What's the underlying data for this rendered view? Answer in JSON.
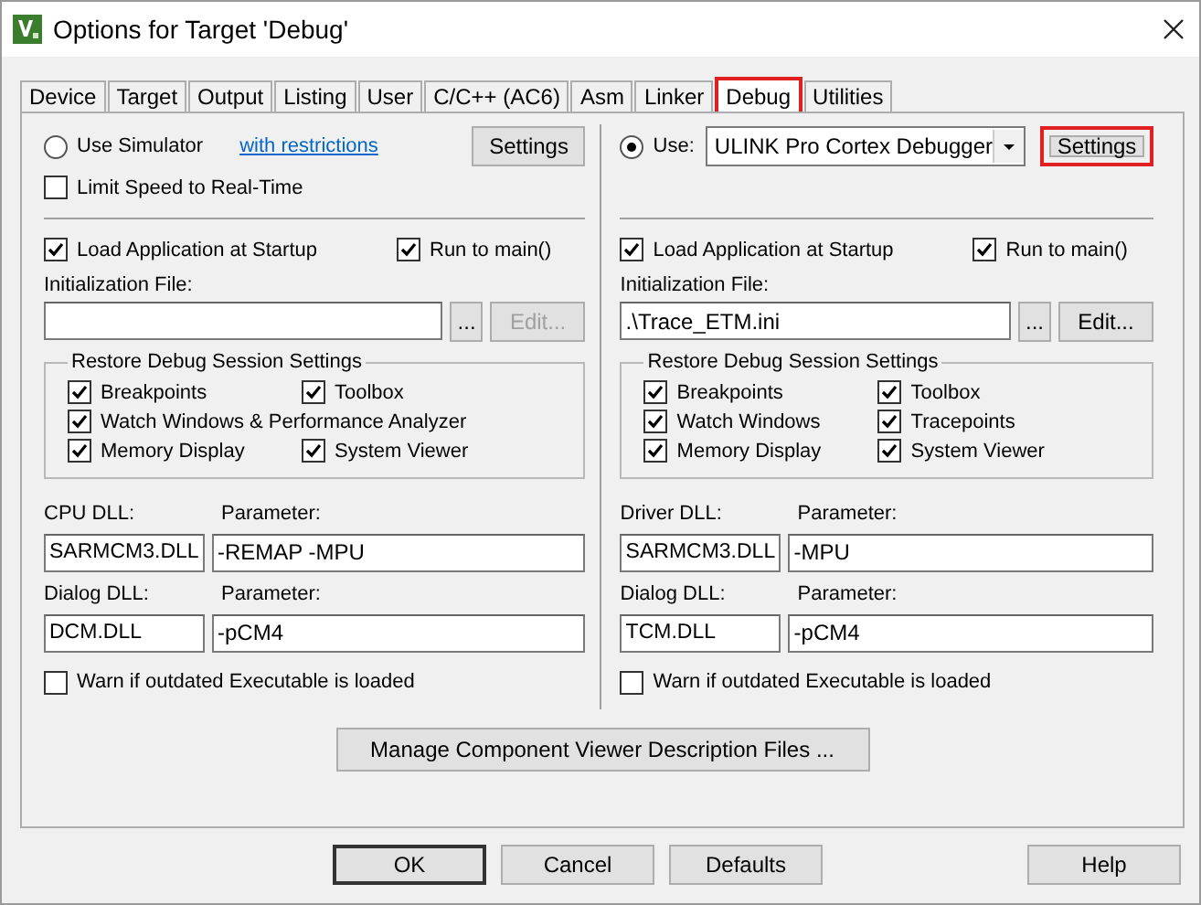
{
  "window": {
    "title": "Options for Target 'Debug'"
  },
  "tabs": [
    {
      "label": "Device",
      "selected": false,
      "highlighted": false
    },
    {
      "label": "Target",
      "selected": false,
      "highlighted": false
    },
    {
      "label": "Output",
      "selected": false,
      "highlighted": false
    },
    {
      "label": "Listing",
      "selected": false,
      "highlighted": false
    },
    {
      "label": "User",
      "selected": false,
      "highlighted": false
    },
    {
      "label": "C/C++ (AC6)",
      "selected": false,
      "highlighted": false
    },
    {
      "label": "Asm",
      "selected": false,
      "highlighted": false
    },
    {
      "label": "Linker",
      "selected": false,
      "highlighted": false
    },
    {
      "label": "Debug",
      "selected": true,
      "highlighted": true
    },
    {
      "label": "Utilities",
      "selected": false,
      "highlighted": false
    }
  ],
  "columns": [
    {
      "source": {
        "kind": "simulator",
        "label": "Use Simulator",
        "selected": false,
        "link": "with restrictions"
      },
      "settings_button": {
        "label": "Settings",
        "highlighted": false
      },
      "limit_speed": {
        "label": "Limit Speed to Real-Time",
        "checked": false
      },
      "load_application": {
        "label": "Load Application at Startup",
        "checked": true
      },
      "run_to_main": {
        "label": "Run to main()",
        "checked": true
      },
      "init_file": {
        "label": "Initialization File:",
        "browse": "...",
        "edit": {
          "label": "Edit...",
          "disabled": true
        }
      },
      "restore": {
        "title": "Restore Debug Session Settings",
        "rows": [
          [
            {
              "label": "Breakpoints",
              "checked": true
            },
            {
              "label": "Toolbox",
              "checked": true
            }
          ],
          [
            {
              "label": "Watch Windows & Performance Analyzer",
              "checked": true
            }
          ],
          [
            {
              "label": "Memory Display",
              "checked": true
            },
            {
              "label": "System Viewer",
              "checked": true
            }
          ]
        ]
      },
      "dlls": [
        {
          "dll_label": "CPU DLL:",
          "dll_value": "SARMCM3.DLL",
          "param_label": "Parameter:",
          "param_value": "-REMAP -MPU"
        },
        {
          "dll_label": "Dialog DLL:",
          "dll_value": "DCM.DLL",
          "param_label": "Parameter:",
          "param_value": "-pCM4"
        }
      ],
      "warn": {
        "label": "Warn if outdated Executable is loaded",
        "checked": false
      }
    },
    {
      "source": {
        "kind": "driver",
        "label": "Use:",
        "selected": true,
        "driver": "ULINK Pro Cortex Debugger"
      },
      "settings_button": {
        "label": "Settings",
        "highlighted": true
      },
      "load_application": {
        "label": "Load Application at Startup",
        "checked": true
      },
      "run_to_main": {
        "label": "Run to main()",
        "checked": true
      },
      "init_file": {
        "label": "Initialization File:",
        "value": ".\\Trace_ETM.ini",
        "browse": "...",
        "edit": {
          "label": "Edit...",
          "disabled": false
        }
      },
      "restore": {
        "title": "Restore Debug Session Settings",
        "rows": [
          [
            {
              "label": "Breakpoints",
              "checked": true
            },
            {
              "label": "Toolbox",
              "checked": true
            }
          ],
          [
            {
              "label": "Watch Windows",
              "checked": true
            },
            {
              "label": "Tracepoints",
              "checked": true
            }
          ],
          [
            {
              "label": "Memory Display",
              "checked": true
            },
            {
              "label": "System Viewer",
              "checked": true
            }
          ]
        ]
      },
      "dlls": [
        {
          "dll_label": "Driver DLL:",
          "dll_value": "SARMCM3.DLL",
          "param_label": "Parameter:",
          "param_value": "-MPU"
        },
        {
          "dll_label": "Dialog DLL:",
          "dll_value": "TCM.DLL",
          "param_label": "Parameter:",
          "param_value": "-pCM4"
        }
      ],
      "warn": {
        "label": "Warn if outdated Executable is loaded",
        "checked": false
      }
    }
  ],
  "manage_button": "Manage Component Viewer Description Files ...",
  "buttons": [
    {
      "label": "OK",
      "default": true
    },
    {
      "label": "Cancel",
      "default": false
    },
    {
      "label": "Defaults",
      "default": false
    },
    {
      "label": "Help",
      "default": false
    }
  ]
}
